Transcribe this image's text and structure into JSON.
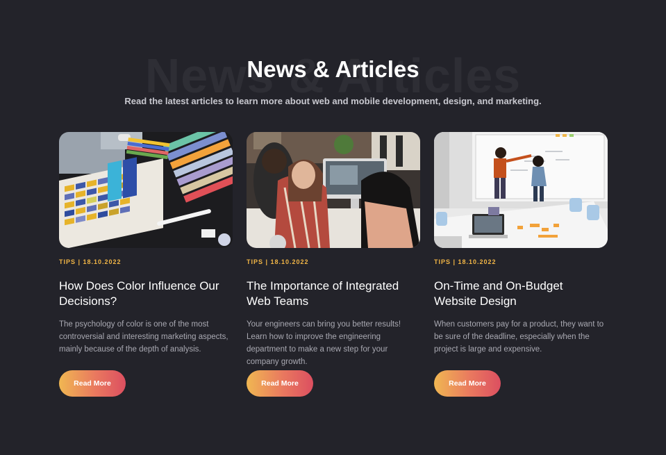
{
  "section": {
    "background_title": "News & Articles",
    "title": "News & Articles",
    "subtitle": "Read the latest articles to learn more about web and mobile development, design, and marketing."
  },
  "colors": {
    "background": "#23232a",
    "accent_meta": "#f2b646",
    "button_gradient_start": "#f0b752",
    "button_gradient_end": "#dc4f60"
  },
  "articles": [
    {
      "image": "color-swatches-photo",
      "meta": "TIPS | 18.10.2022",
      "title": "How Does Color Influence Our Decisions?",
      "excerpt": "The psychology of color is one of the most controversial and interesting marketing aspects, mainly because of the depth of analysis.",
      "button": "Read More"
    },
    {
      "image": "team-at-computer-photo",
      "meta": "TIPS | 18.10.2022",
      "title": "The Importance of Integrated Web Teams",
      "excerpt": "Your engineers can bring you better results! Learn how to improve the engineering department to make a new step for your company growth.",
      "button": "Read More"
    },
    {
      "image": "whiteboard-meeting-photo",
      "meta": "TIPS | 18.10.2022",
      "title": "On-Time and On-Budget Website Design",
      "excerpt": "When customers pay for a product, they want to be sure of the deadline, especially when the project is large and expensive.",
      "button": "Read More"
    }
  ]
}
